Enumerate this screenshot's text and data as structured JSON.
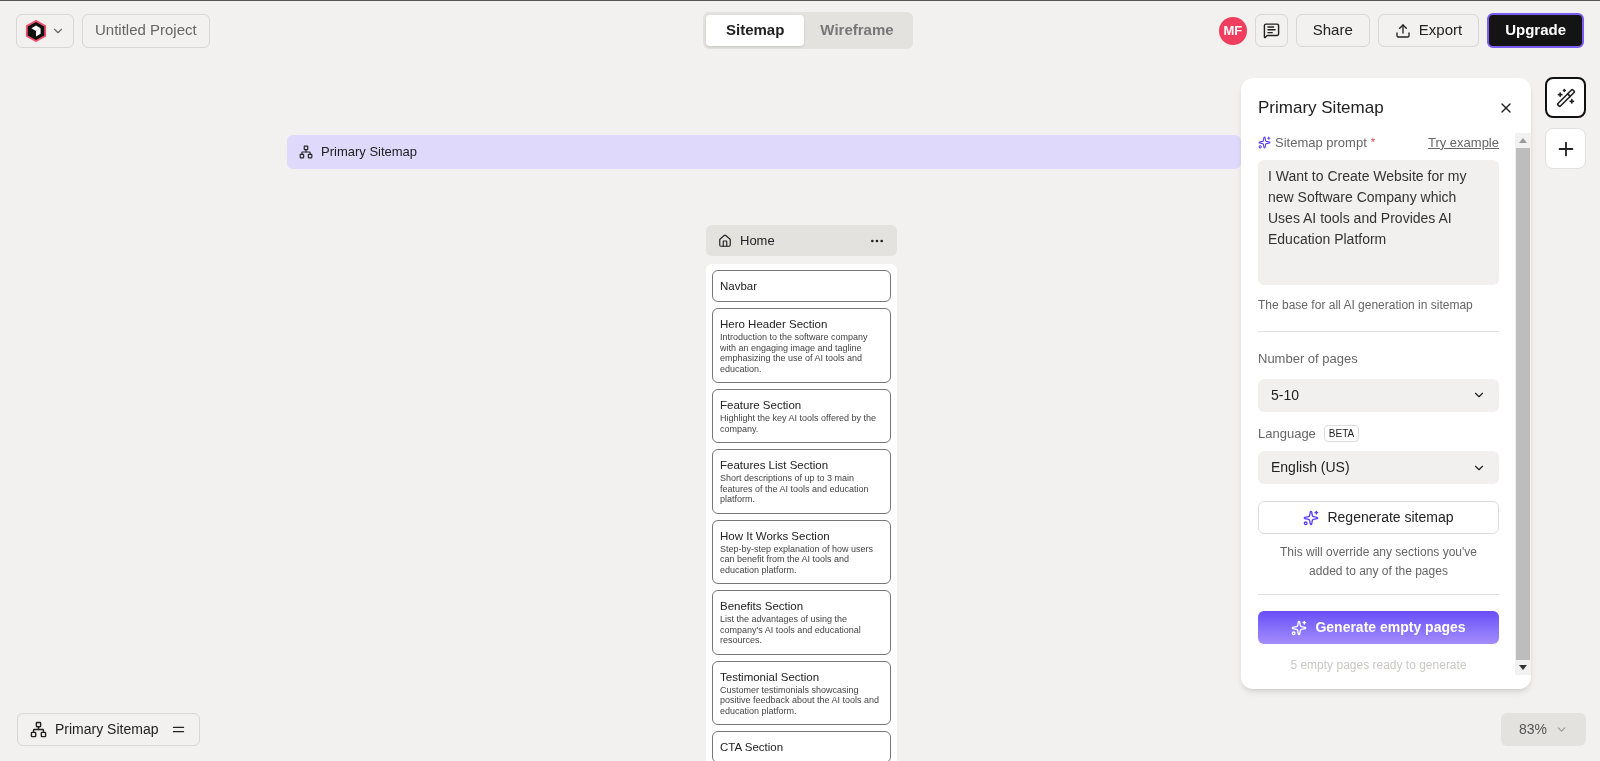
{
  "header": {
    "project_title": "Untitled Project",
    "tabs": [
      {
        "label": "Sitemap",
        "selected": true
      },
      {
        "label": "Wireframe",
        "selected": false
      }
    ],
    "avatar": "MF",
    "share": "Share",
    "export": "Export",
    "upgrade": "Upgrade"
  },
  "canvas": {
    "sitemap_bar": "Primary Sitemap",
    "page": {
      "title": "Home",
      "sections": [
        {
          "title": "Navbar"
        },
        {
          "title": "Hero Header Section",
          "description": "Introduction to the software company with an engaging image and tagline emphasizing the use of AI tools and education."
        },
        {
          "title": "Feature Section",
          "description": "Highlight the key AI tools offered by the company."
        },
        {
          "title": "Features List Section",
          "description": "Short descriptions of up to 3 main features of the AI tools and education platform."
        },
        {
          "title": "How It Works Section",
          "description": "Step-by-step explanation of how users can benefit from the AI tools and education platform."
        },
        {
          "title": "Benefits Section",
          "description": "List the advantages of using the company's AI tools and educational resources."
        },
        {
          "title": "Testimonial Section",
          "description": "Customer testimonials showcasing positive feedback about the AI tools and education platform."
        },
        {
          "title": "CTA Section"
        }
      ]
    }
  },
  "panel": {
    "title": "Primary Sitemap",
    "prompt_label": "Sitemap prompt",
    "required_mark": "*",
    "try_example": "Try example",
    "prompt_value": "I Want to Create Website for my new Software Company which Uses AI tools and Provides AI Education Platform",
    "prompt_hint": "The base for all AI generation in sitemap",
    "pages_label": "Number of pages",
    "pages_value": "5-10",
    "language_label": "Language",
    "language_badge": "BETA",
    "language_value": "English (US)",
    "regenerate_button": "Regenerate sitemap",
    "regenerate_note": "This will override any sections you've added to any of the pages",
    "generate_button": "Generate empty pages",
    "generate_note": "5 empty pages ready to generate"
  },
  "footer": {
    "sitemap_switcher": "Primary Sitemap",
    "zoom": "83%"
  }
}
